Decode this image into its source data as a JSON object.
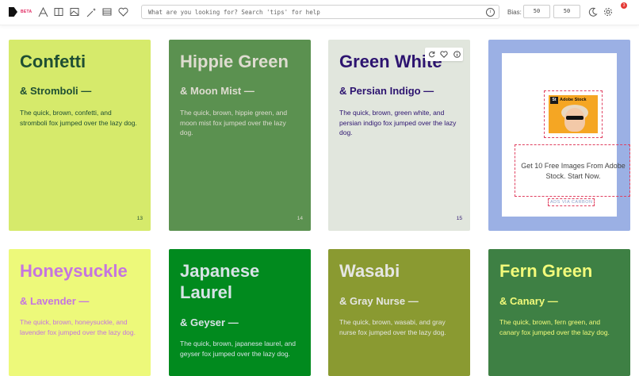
{
  "topbar": {
    "beta": "BETA",
    "search_placeholder": "What are you looking for? Search 'tips' for help",
    "bias_label": "Bias:",
    "bias_left": "50",
    "bias_right": "50",
    "notifications": "3",
    "icons": [
      "font-icon",
      "columns-icon",
      "image-icon",
      "magic-icon",
      "layout-icon",
      "heart-icon",
      "info-icon",
      "moon-icon",
      "gear-icon"
    ]
  },
  "cards": [
    {
      "name": "Confetti",
      "sub": "& Stromboli —",
      "desc": "The quick, brown, confetti, and stromboli fox jumped over the lazy dog.",
      "num": "13",
      "bg": "#d6ea6b",
      "fg": "#1f4f33"
    },
    {
      "name": "Hippie Green",
      "sub": "& Moon Mist —",
      "desc": "The quick, brown, hippie green, and moon mist fox jumped over the lazy dog.",
      "num": "14",
      "bg": "#5b9150",
      "fg": "#dedcd0"
    },
    {
      "name": "Green White",
      "sub": "& Persian Indigo —",
      "desc": "The quick, brown, green white, and persian indigo fox jumped over the lazy dog.",
      "num": "15",
      "bg": "#e1e6dd",
      "fg": "#2d1470"
    },
    {
      "name": "Honeysuckle",
      "sub": "& Lavender —",
      "desc": "The quick, brown, honeysuckle, and lavender fox jumped over the lazy dog.",
      "num": "",
      "bg": "#edf97a",
      "fg": "#c575e0"
    },
    {
      "name": "Japanese Laurel",
      "sub": "& Geyser —",
      "desc": "The quick, brown, japanese laurel, and geyser fox jumped over the lazy dog.",
      "num": "",
      "bg": "#018a1e",
      "fg": "#d7e3e6"
    },
    {
      "name": "Wasabi",
      "sub": "& Gray Nurse —",
      "desc": "The quick, brown, wasabi, and gray nurse fox jumped over the lazy dog.",
      "num": "",
      "bg": "#8a9a31",
      "fg": "#e5e6e2"
    },
    {
      "name": "Fern Green",
      "sub": "& Canary —",
      "desc": "The quick, brown, fern green, and canary fox jumped over the lazy dog.",
      "num": "",
      "bg": "#3e8044",
      "fg": "#f2fa7a"
    }
  ],
  "ad": {
    "brand": "Adobe Stock",
    "brand_short": "St",
    "text": "Get 10 Free Images From Adobe Stock. Start Now.",
    "via": "ADS VIA CARBON",
    "bg": "#9bb0e4"
  }
}
